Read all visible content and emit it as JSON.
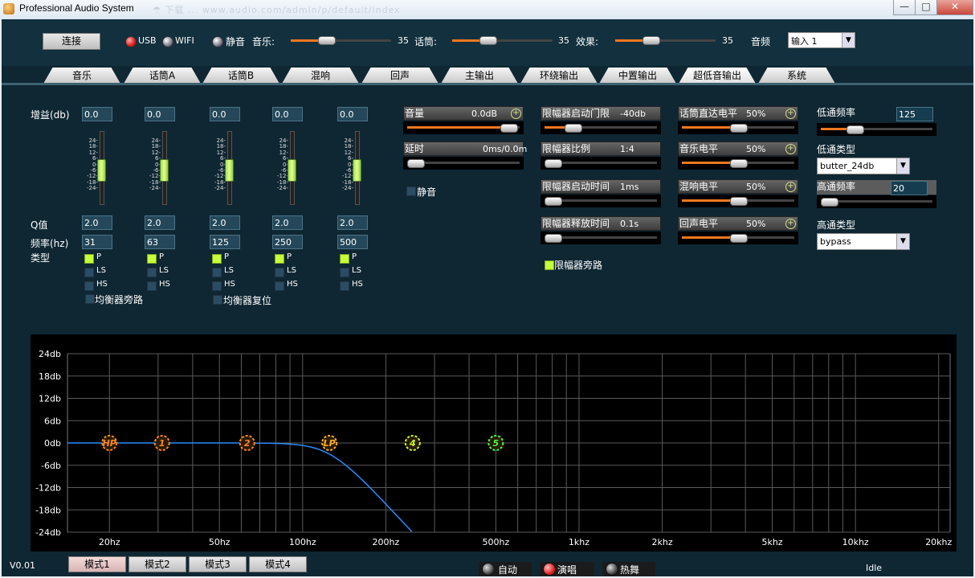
{
  "window": {
    "title": "Professional Audio System",
    "blurred_text": "☂ 下载 ...   www.audio.com/admin/p/default/index"
  },
  "topbar": {
    "connect": "连接",
    "usb": "USB",
    "wifi": "WIFI",
    "mute": "静音",
    "music": {
      "label": "音乐:",
      "value": "35",
      "level": 0.35
    },
    "mic": {
      "label": "话筒:",
      "value": "35",
      "level": 0.35
    },
    "effect": {
      "label": "效果:",
      "value": "35",
      "level": 0.35
    },
    "source": {
      "label": "音频",
      "value": "输入 1"
    }
  },
  "tabs": [
    "音乐",
    "话筒A",
    "话筒B",
    "混响",
    "回声",
    "主输出",
    "环绕输出",
    "中置输出",
    "超低音输出",
    "系统"
  ],
  "active_tab": "超低音输出",
  "eq": {
    "gain_label": "增益(db)",
    "q_label": "Q值",
    "freq_label": "频率(hz)",
    "type_label": "类型",
    "scale": [
      "24-",
      "18-",
      "12-",
      "6-",
      "0-",
      "-6-",
      "-12-",
      "-18-",
      "-24-"
    ],
    "bands": [
      {
        "gain": "0.0",
        "q": "2.0",
        "freq": "31"
      },
      {
        "gain": "0.0",
        "q": "2.0",
        "freq": "63"
      },
      {
        "gain": "0.0",
        "q": "2.0",
        "freq": "125"
      },
      {
        "gain": "0.0",
        "q": "2.0",
        "freq": "250"
      },
      {
        "gain": "0.0",
        "q": "2.0",
        "freq": "500"
      }
    ],
    "types": [
      "P",
      "LS",
      "HS"
    ],
    "bypass": "均衡器旁路",
    "reset": "均衡器复位"
  },
  "volume": {
    "label": "音量",
    "value": "0.0dB",
    "level": 0.9
  },
  "delay": {
    "label": "延时",
    "value": "0ms/0.0m",
    "level": 0.0
  },
  "mute2": "静音",
  "limiter": {
    "threshold": {
      "label": "限幅器启动门限",
      "value": "-40db",
      "level": 0.25
    },
    "ratio": {
      "label": "限幅器比例",
      "value": "1:4",
      "level": 0.05
    },
    "attack": {
      "label": "限幅器启动时间",
      "value": "1ms",
      "level": 0.0
    },
    "release": {
      "label": "限幅器释放时间",
      "value": "0.1s",
      "level": 0.0
    },
    "bypass": "限幅器旁路"
  },
  "levels": {
    "mic_direct": {
      "label": "话筒直达电平",
      "value": "50%",
      "level": 0.5
    },
    "music": {
      "label": "音乐电平",
      "value": "50%",
      "level": 0.5
    },
    "reverb": {
      "label": "混响电平",
      "value": "50%",
      "level": 0.5
    },
    "echo": {
      "label": "回声电平",
      "value": "50%",
      "level": 0.5
    }
  },
  "filters": {
    "lowpass_freq_label": "低通频率",
    "lowpass_freq": "125",
    "lowpass_level": 0.3,
    "lowpass_type_label": "低通类型",
    "lowpass_type": "butter_24db",
    "highpass_freq_label": "高通频率",
    "highpass_freq": "20",
    "highpass_level": 0.0,
    "highpass_type_label": "高通类型",
    "highpass_type": "bypass"
  },
  "eq_chart": {
    "y_ticks": [
      "24db",
      "18db",
      "12db",
      "6db",
      "0db",
      "-6db",
      "-12db",
      "-18db",
      "-24db"
    ],
    "x_ticks": [
      {
        "label": "20hz",
        "f": 20
      },
      {
        "label": "50hz",
        "f": 50
      },
      {
        "label": "100hz",
        "f": 100
      },
      {
        "label": "200hz",
        "f": 200
      },
      {
        "label": "500hz",
        "f": 500
      },
      {
        "label": "1khz",
        "f": 1000
      },
      {
        "label": "2khz",
        "f": 2000
      },
      {
        "label": "5khz",
        "f": 5000
      },
      {
        "label": "10khz",
        "f": 10000
      },
      {
        "label": "20khz",
        "f": 20000
      }
    ],
    "markers": [
      {
        "label": "HP",
        "f": 20,
        "db": 0,
        "color": "#ff8a1e"
      },
      {
        "label": "1",
        "f": 31,
        "db": 0,
        "color": "#ff8a1e"
      },
      {
        "label": "2",
        "f": 63,
        "db": 0,
        "color": "#ff8a1e"
      },
      {
        "label": "LP",
        "f": 125,
        "db": 0,
        "color": "#ffb020"
      },
      {
        "label": "4",
        "f": 250,
        "db": 0,
        "color": "#c8ff2a"
      },
      {
        "label": "5",
        "f": 500,
        "db": 0,
        "color": "#44ff44"
      }
    ]
  },
  "footer": {
    "version": "V0.01",
    "modes": [
      "模式1",
      "模式2",
      "模式3",
      "模式4"
    ],
    "auto": "自动",
    "sing": "演唱",
    "dance": "热舞",
    "status": "Idle"
  }
}
